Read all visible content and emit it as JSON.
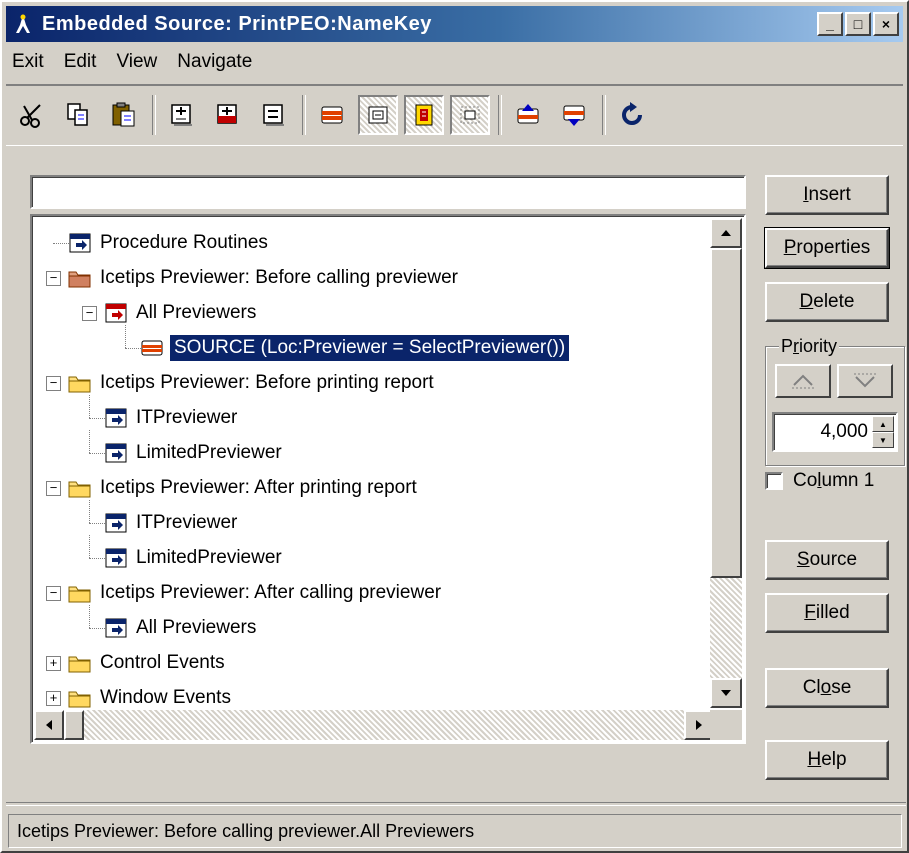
{
  "window": {
    "title": "Embedded Source: PrintPEO:NameKey",
    "controls": {
      "minimize": "_",
      "maximize": "□",
      "close": "×"
    }
  },
  "menu": [
    "Exit",
    "Edit",
    "View",
    "Navigate"
  ],
  "toolbar": {
    "icons": [
      "cut-icon",
      "copy-icon",
      "paste-icon",
      "insert-above-icon",
      "insert-below-icon",
      "insert-after-icon",
      "delete-embed-icon",
      "view-code-icon",
      "embed-filled-icon",
      "view-selected-icon",
      "previous-embed-icon",
      "next-embed-icon",
      "refresh-icon"
    ]
  },
  "search": {
    "value": "",
    "placeholder": ""
  },
  "tree": {
    "nodes": [
      {
        "label": "Procedure Routines",
        "level": 0,
        "expander": "none",
        "icon": "embed-point-icon"
      },
      {
        "label": "Icetips Previewer:  Before calling previewer",
        "level": 0,
        "expander": "minus",
        "icon": "open-folder-red-icon"
      },
      {
        "label": "All Previewers",
        "level": 1,
        "expander": "minus",
        "icon": "embed-point-red-icon"
      },
      {
        "label": "SOURCE (Loc:Previewer = SelectPreviewer())",
        "level": 2,
        "expander": "none",
        "icon": "source-embed-icon",
        "selected": true
      },
      {
        "label": "Icetips Previewer:  Before printing report",
        "level": 0,
        "expander": "minus",
        "icon": "folder-icon"
      },
      {
        "label": "ITPreviewer",
        "level": 1,
        "expander": "none",
        "icon": "embed-point-icon"
      },
      {
        "label": "LimitedPreviewer",
        "level": 1,
        "expander": "none",
        "icon": "embed-point-icon"
      },
      {
        "label": "Icetips Previewer:  After printing report",
        "level": 0,
        "expander": "minus",
        "icon": "folder-icon"
      },
      {
        "label": "ITPreviewer",
        "level": 1,
        "expander": "none",
        "icon": "embed-point-icon"
      },
      {
        "label": "LimitedPreviewer",
        "level": 1,
        "expander": "none",
        "icon": "embed-point-icon"
      },
      {
        "label": "Icetips Previewer:  After calling previewer",
        "level": 0,
        "expander": "minus",
        "icon": "folder-icon"
      },
      {
        "label": "All Previewers",
        "level": 1,
        "expander": "none",
        "icon": "embed-point-icon"
      },
      {
        "label": "Control Events",
        "level": 0,
        "expander": "plus",
        "icon": "folder-icon"
      },
      {
        "label": "Window Events",
        "level": 0,
        "expander": "plus",
        "icon": "folder-icon"
      }
    ]
  },
  "buttons": {
    "insert": {
      "pre": "",
      "key": "I",
      "post": "nsert"
    },
    "properties": {
      "pre": "",
      "key": "P",
      "post": "roperties"
    },
    "delete": {
      "pre": "",
      "key": "D",
      "post": "elete"
    },
    "source": {
      "pre": "",
      "key": "S",
      "post": "ource"
    },
    "filled": {
      "pre": "",
      "key": "F",
      "post": "illed"
    },
    "close": {
      "pre": "Cl",
      "key": "o",
      "post": "se"
    },
    "help": {
      "pre": "",
      "key": "H",
      "post": "elp"
    }
  },
  "priority": {
    "label_pre": "P",
    "label_key": "r",
    "label_post": "iority",
    "value": "4,000"
  },
  "column": {
    "pre": "Co",
    "key": "l",
    "post": "umn 1",
    "checked": false
  },
  "status": {
    "text": "Icetips Previewer:  Before calling previewer.All Previewers"
  },
  "colors": {
    "selection": "#0a246a",
    "titlebar": "#0a246a",
    "face": "#d4d0c8"
  }
}
